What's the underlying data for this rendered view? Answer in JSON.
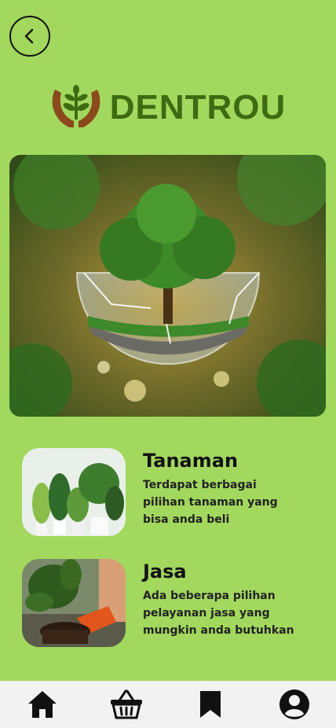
{
  "header": {
    "back_icon": "chevron-left-icon"
  },
  "brand": {
    "name": "DENTROU",
    "logo_icon": "plant-hands-icon",
    "color": "#3e6b12"
  },
  "hero": {
    "image": "tree-in-glass-sphere"
  },
  "categories": [
    {
      "title": "Tanaman",
      "description": "Terdapat berbagai pilihan tanaman yang bisa anda beli",
      "image": "potted-plants"
    },
    {
      "title": "Jasa",
      "description": "Ada beberapa pilihan pelayanan jasa yang mungkin anda butuhkan",
      "image": "gardener-repotting-plant"
    }
  ],
  "bottom_nav": [
    {
      "icon": "home-icon"
    },
    {
      "icon": "basket-icon"
    },
    {
      "icon": "bookmark-icon"
    },
    {
      "icon": "profile-icon"
    }
  ],
  "colors": {
    "background": "#a3d85f",
    "navbar": "#f2f2f2"
  }
}
